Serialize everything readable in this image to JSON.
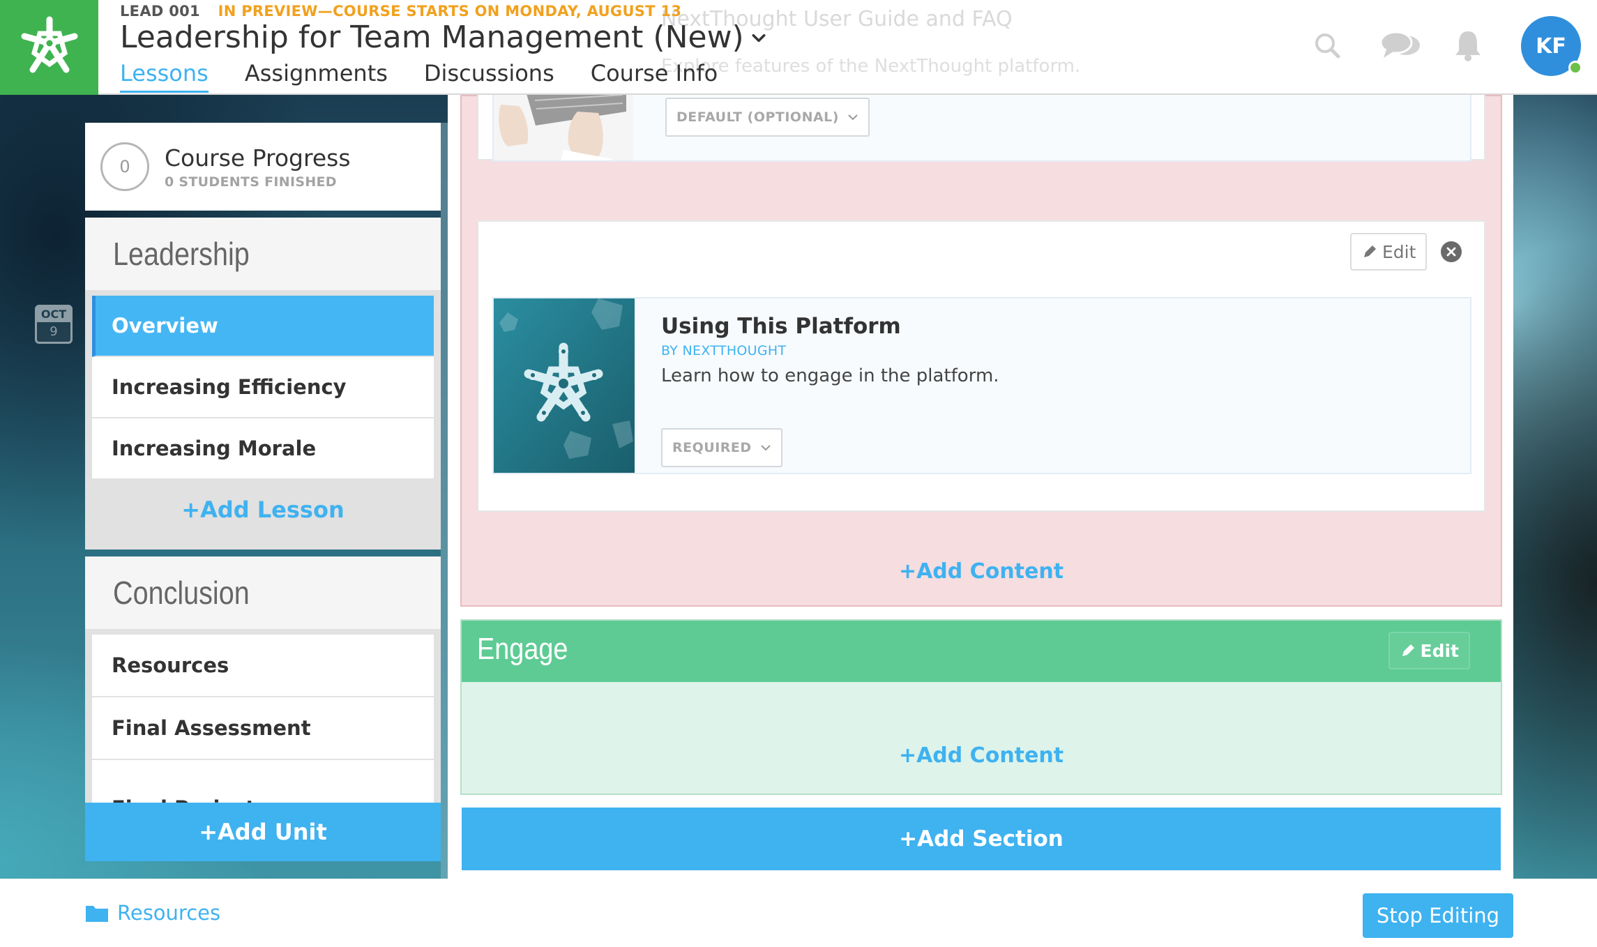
{
  "header": {
    "course_code": "LEAD 001",
    "preview_notice": "IN PREVIEW—COURSE STARTS ON MONDAY, AUGUST 13",
    "course_title": "Leadership for Team Management (New)",
    "tabs": [
      {
        "label": "Lessons",
        "active": true
      },
      {
        "label": "Assignments",
        "active": false
      },
      {
        "label": "Discussions",
        "active": false
      },
      {
        "label": "Course Info",
        "active": false
      }
    ],
    "obscured_item_title": "NextThought User Guide and FAQ",
    "obscured_item_desc": "Explore features of the NextThought platform.",
    "icons": [
      "search-icon",
      "chat-icon",
      "notification-bell-icon"
    ],
    "avatar_initials": "KF",
    "brand_color": "#3fb34f",
    "accent_color": "#3fb2f0"
  },
  "date_badge": {
    "month": "OCT",
    "day": "9"
  },
  "sidebar": {
    "progress": {
      "value": "0",
      "title": "Course Progress",
      "subtitle": "0 STUDENTS FINISHED"
    },
    "units": [
      {
        "title": "Leadership",
        "lessons": [
          {
            "label": "Overview",
            "active": true
          },
          {
            "label": "Increasing Efficiency",
            "active": false
          },
          {
            "label": "Increasing Morale",
            "active": false
          }
        ],
        "add_lesson_label": "+Add Lesson"
      },
      {
        "title": "Conclusion",
        "lessons": [
          {
            "label": "Resources",
            "active": false
          },
          {
            "label": "Final Assessment",
            "active": false
          },
          {
            "label": "Final Project",
            "active": false
          }
        ]
      }
    ],
    "add_unit_label": "+Add Unit"
  },
  "main": {
    "first_item": {
      "requirement": "DEFAULT (OPTIONAL)"
    },
    "second_item": {
      "edit_label": "Edit",
      "title": "Using This Platform",
      "author": "BY NEXTTHOUGHT",
      "description": "Learn how to engage in the platform.",
      "requirement": "REQUIRED"
    },
    "pink_add_content_label": "+Add Content",
    "engage": {
      "title": "Engage",
      "edit_label": "Edit",
      "add_content_label": "+Add Content"
    },
    "add_section_label": "+Add Section"
  },
  "footer": {
    "resources_label": "Resources",
    "stop_editing_label": "Stop Editing"
  }
}
